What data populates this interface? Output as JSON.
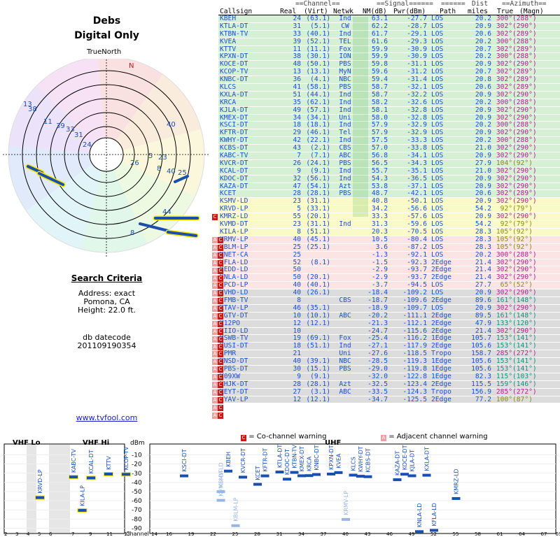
{
  "header": {
    "site_name": "Debs",
    "mode": "Digital Only",
    "north_label": "TrueNorth",
    "north_marker": "N"
  },
  "polar_labels": [
    "13",
    "38",
    "11",
    "39",
    "33",
    "31",
    "24",
    "40",
    "5",
    "23",
    "26",
    "8",
    "40",
    "25",
    "8",
    "44"
  ],
  "search": {
    "heading": "Search Criteria",
    "address": "Address: exact",
    "city": "Pomona, CA",
    "height": "Height: 22.0 ft.",
    "db_label": "db datecode",
    "db_value": "201109190354"
  },
  "link": "www.tvfool.com",
  "table_headers": {
    "group_channel": "==Channel==",
    "group_signal": "==Signal======",
    "group_dist": "Dist",
    "group_azimuth": "==Azimuth==",
    "callsign": "Callsign",
    "real": "Real",
    "virt": "(Virt)",
    "netwk": "Netwk",
    "nm": "NM(dB)",
    "pwr": "Pwr(dBm)",
    "path": "Path",
    "miles": "miles",
    "true": "True",
    "magn": "(Magn)"
  },
  "colors": {
    "green": "#d6f0d6",
    "yellow": "#fafac8",
    "pink": "#fbe4e4",
    "gray": "#dcdcdc",
    "blue": "#1a4fd0",
    "magenta": "#b02090",
    "olive": "#8a8a10",
    "teal": "#109080",
    "coch": "#c81818",
    "adj": "#e8a0a0"
  },
  "stations": [
    {
      "call": "KBEH",
      "real": "24",
      "virt": "(63.1)",
      "net": "Ind",
      "nm": "63.1",
      "pwr": "-27.7",
      "path": "LOS",
      "dist": "20.2",
      "az": "300°",
      "mag": "(288°)",
      "band": "green"
    },
    {
      "call": "KTLA-DT",
      "real": "31",
      "virt": "(5.1)",
      "net": "CW",
      "nm": "62.2",
      "pwr": "-28.7",
      "path": "LOS",
      "dist": "20.9",
      "az": "302°",
      "mag": "(290°)",
      "band": "green"
    },
    {
      "call": "KTBN-TV",
      "real": "33",
      "virt": "(40.1)",
      "net": "Ind",
      "nm": "61.7",
      "pwr": "-29.1",
      "path": "LOS",
      "dist": "20.6",
      "az": "302°",
      "mag": "(289°)",
      "band": "green"
    },
    {
      "call": "KVEA",
      "real": "39",
      "virt": "(52.1)",
      "net": "TEL",
      "nm": "61.6",
      "pwr": "-29.3",
      "path": "LOS",
      "dist": "20.2",
      "az": "300°",
      "mag": "(288°)",
      "band": "green"
    },
    {
      "call": "KTTV",
      "real": "11",
      "virt": "(11.1)",
      "net": "Fox",
      "nm": "59.9",
      "pwr": "-30.9",
      "path": "LOS",
      "dist": "20.7",
      "az": "302°",
      "mag": "(289°)",
      "band": "green"
    },
    {
      "call": "KPXN-DT",
      "real": "38",
      "virt": "(30.1)",
      "net": "ION",
      "nm": "59.9",
      "pwr": "-30.9",
      "path": "LOS",
      "dist": "20.2",
      "az": "300°",
      "mag": "(288°)",
      "band": "green"
    },
    {
      "call": "KOCE-DT",
      "real": "48",
      "virt": "(50.1)",
      "net": "PBS",
      "nm": "59.8",
      "pwr": "-31.1",
      "path": "LOS",
      "dist": "20.9",
      "az": "302°",
      "mag": "(290°)",
      "band": "green"
    },
    {
      "call": "KCOP-TV",
      "real": "13",
      "virt": "(13.1)",
      "net": "MyN",
      "nm": "59.6",
      "pwr": "-31.2",
      "path": "LOS",
      "dist": "20.7",
      "az": "302°",
      "mag": "(289°)",
      "band": "green"
    },
    {
      "call": "KNBC-DT",
      "real": "36",
      "virt": "(4.1)",
      "net": "NBC",
      "nm": "59.4",
      "pwr": "-31.4",
      "path": "LOS",
      "dist": "20.8",
      "az": "302°",
      "mag": "(289°)",
      "band": "green"
    },
    {
      "call": "KLCS",
      "real": "41",
      "virt": "(58.1)",
      "net": "PBS",
      "nm": "58.7",
      "pwr": "-32.1",
      "path": "LOS",
      "dist": "20.6",
      "az": "302°",
      "mag": "(289°)",
      "band": "green"
    },
    {
      "call": "KXLA-DT",
      "real": "51",
      "virt": "(44.1)",
      "net": "Ind",
      "nm": "58.7",
      "pwr": "-32.2",
      "path": "LOS",
      "dist": "20.9",
      "az": "302°",
      "mag": "(290°)",
      "band": "green"
    },
    {
      "call": "KRCA",
      "real": "35",
      "virt": "(62.1)",
      "net": "Ind",
      "nm": "58.2",
      "pwr": "-32.6",
      "path": "LOS",
      "dist": "20.2",
      "az": "300°",
      "mag": "(288°)",
      "band": "green"
    },
    {
      "call": "KJLA-DT",
      "real": "49",
      "virt": "(57.1)",
      "net": "Ind",
      "nm": "58.1",
      "pwr": "-32.8",
      "path": "LOS",
      "dist": "20.9",
      "az": "302°",
      "mag": "(290°)",
      "band": "green"
    },
    {
      "call": "KMEX-DT",
      "real": "34",
      "virt": "(34.1)",
      "net": "Uni",
      "nm": "58.0",
      "pwr": "-32.8",
      "path": "LOS",
      "dist": "20.9",
      "az": "302°",
      "mag": "(290°)",
      "band": "green"
    },
    {
      "call": "KSCI-DT",
      "real": "18",
      "virt": "(18.1)",
      "net": "Ind",
      "nm": "57.9",
      "pwr": "-32.9",
      "path": "LOS",
      "dist": "20.2",
      "az": "300°",
      "mag": "(288°)",
      "band": "green"
    },
    {
      "call": "KFTR-DT",
      "real": "29",
      "virt": "(46.1)",
      "net": "Tel",
      "nm": "57.9",
      "pwr": "-32.9",
      "path": "LOS",
      "dist": "20.9",
      "az": "302°",
      "mag": "(290°)",
      "band": "green"
    },
    {
      "call": "KWHY-DT",
      "real": "42",
      "virt": "(22.1)",
      "net": "Ind",
      "nm": "57.5",
      "pwr": "-33.3",
      "path": "LOS",
      "dist": "20.2",
      "az": "300°",
      "mag": "(288°)",
      "band": "green"
    },
    {
      "call": "KCBS-DT",
      "real": "43",
      "virt": "(2.1)",
      "net": "CBS",
      "nm": "57.0",
      "pwr": "-33.8",
      "path": "LOS",
      "dist": "21.0",
      "az": "302°",
      "mag": "(290°)",
      "band": "green"
    },
    {
      "call": "KABC-TV",
      "real": "7",
      "virt": "(7.1)",
      "net": "ABC",
      "nm": "56.8",
      "pwr": "-34.1",
      "path": "LOS",
      "dist": "20.9",
      "az": "302°",
      "mag": "(290°)",
      "band": "green"
    },
    {
      "call": "KVCR-DT",
      "real": "26",
      "virt": "(24.1)",
      "net": "PBS",
      "nm": "56.5",
      "pwr": "-34.3",
      "path": "LOS",
      "dist": "27.9",
      "az": "104°",
      "mag": "(92°)",
      "band": "green",
      "azc": "olive"
    },
    {
      "call": "KCAL-DT",
      "real": "9",
      "virt": "(9.1)",
      "net": "Ind",
      "nm": "55.7",
      "pwr": "-35.1",
      "path": "LOS",
      "dist": "21.0",
      "az": "302°",
      "mag": "(290°)",
      "band": "green"
    },
    {
      "call": "KDOC-DT",
      "real": "32",
      "virt": "(56.1)",
      "net": "Ind",
      "nm": "54.3",
      "pwr": "-36.5",
      "path": "LOS",
      "dist": "20.9",
      "az": "302°",
      "mag": "(290°)",
      "band": "green"
    },
    {
      "call": "KAZA-DT",
      "real": "47",
      "virt": "(54.1)",
      "net": "Azt",
      "nm": "53.8",
      "pwr": "-37.1",
      "path": "LOS",
      "dist": "20.9",
      "az": "302°",
      "mag": "(290°)",
      "band": "green"
    },
    {
      "call": "KCET",
      "real": "28",
      "virt": "(28.1)",
      "net": "PBS",
      "nm": "48.7",
      "pwr": "-42.1",
      "path": "LOS",
      "dist": "20.6",
      "az": "302°",
      "mag": "(289°)",
      "band": "green"
    },
    {
      "call": "KSMV-LD",
      "real": "23",
      "virt": "(31.1)",
      "net": "",
      "nm": "40.8",
      "pwr": "-50.1",
      "path": "LOS",
      "dist": "20.9",
      "az": "302°",
      "mag": "(290°)",
      "band": "yellow",
      "warn": "C"
    },
    {
      "call": "KRVD-LP",
      "real": "5",
      "virt": "(33.1)",
      "net": "",
      "nm": "34.2",
      "pwr": "-56.6",
      "path": "LOS",
      "dist": "54.2",
      "az": "92°",
      "mag": "(79°)",
      "band": "yellow",
      "azc": "olive"
    },
    {
      "call": "KMRZ-LD",
      "real": "55",
      "virt": "(20.1)",
      "net": "",
      "nm": "33.3",
      "pwr": "-57.6",
      "path": "LOS",
      "dist": "20.9",
      "az": "302°",
      "mag": "(290°)",
      "band": "yellow"
    },
    {
      "call": "KVMD-DT",
      "real": "23",
      "virt": "(31.1)",
      "net": "Ind",
      "nm": "31.3",
      "pwr": "-59.6",
      "path": "LOS",
      "dist": "54.2",
      "az": "92°",
      "mag": "(79°)",
      "band": "yellow",
      "warn": "AC",
      "azc": "olive"
    },
    {
      "call": "KILA-LP",
      "real": "8",
      "virt": "(51.1)",
      "net": "",
      "nm": "20.3",
      "pwr": "-70.5",
      "path": "LOS",
      "dist": "28.3",
      "az": "105°",
      "mag": "(92°)",
      "band": "yellow",
      "warn": "AC",
      "azc": "olive"
    },
    {
      "call": "KRMV-LP",
      "real": "40",
      "virt": "(45.1)",
      "net": "",
      "nm": "10.5",
      "pwr": "-80.4",
      "path": "LOS",
      "dist": "28.3",
      "az": "105°",
      "mag": "(92°)",
      "band": "pink",
      "warn": "AC",
      "azc": "olive"
    },
    {
      "call": "KBLM-LP",
      "real": "25",
      "virt": "(25.1)",
      "net": "",
      "nm": "3.6",
      "pwr": "-87.2",
      "path": "LOS",
      "dist": "28.3",
      "az": "105°",
      "mag": "(92°)",
      "band": "pink",
      "warn": "AC",
      "azc": "olive"
    },
    {
      "call": "KNET-CA",
      "real": "25",
      "virt": "",
      "net": "",
      "nm": "-1.3",
      "pwr": "-92.1",
      "path": "LOS",
      "dist": "20.2",
      "az": "300°",
      "mag": "(288°)",
      "band": "pink",
      "warn": "AC"
    },
    {
      "call": "KFLA-LD",
      "real": "52",
      "virt": "(8.1)",
      "net": "",
      "nm": "-1.5",
      "pwr": "-92.3",
      "path": "2Edge",
      "dist": "21.4",
      "az": "302°",
      "mag": "(290°)",
      "band": "pink",
      "warn": "AC"
    },
    {
      "call": "KEDD-LD",
      "real": "50",
      "virt": "",
      "net": "",
      "nm": "-2.9",
      "pwr": "-93.7",
      "path": "2Edge",
      "dist": "21.4",
      "az": "302°",
      "mag": "(290°)",
      "band": "pink",
      "warn": "AC"
    },
    {
      "call": "KNLA-LD",
      "real": "50",
      "virt": "(20.1)",
      "net": "",
      "nm": "-2.9",
      "pwr": "-93.7",
      "path": "2Edge",
      "dist": "21.4",
      "az": "302°",
      "mag": "(290°)",
      "band": "pink",
      "warn": "AC"
    },
    {
      "call": "KPCD-LP",
      "real": "40",
      "virt": "(40.1)",
      "net": "",
      "nm": "-3.7",
      "pwr": "-94.5",
      "path": "LOS",
      "dist": "27.7",
      "az": "65°",
      "mag": "(52°)",
      "band": "pink",
      "warn": "AC",
      "azc": "olive"
    },
    {
      "call": "KVHD-LD",
      "real": "40",
      "virt": "(26.1)",
      "net": "",
      "nm": "-18.4",
      "pwr": "-109.2",
      "path": "LOS",
      "dist": "20.9",
      "az": "302°",
      "mag": "(290°)",
      "band": "gray",
      "warn": "AC"
    },
    {
      "call": "KFMB-TV",
      "real": "8",
      "virt": "",
      "net": "CBS",
      "nm": "-18.7",
      "pwr": "-109.6",
      "path": "2Edge",
      "dist": "89.6",
      "az": "161°",
      "mag": "(148°)",
      "band": "gray",
      "warn": "AC",
      "azc": "teal"
    },
    {
      "call": "KTAV-LP",
      "real": "46",
      "virt": "(35.1)",
      "net": "",
      "nm": "-18.9",
      "pwr": "-109.7",
      "path": "LOS",
      "dist": "20.9",
      "az": "302°",
      "mag": "(290°)",
      "band": "gray",
      "warn": "AC"
    },
    {
      "call": "KGTV-DT",
      "real": "10",
      "virt": "(10.1)",
      "net": "ABC",
      "nm": "-20.2",
      "pwr": "-111.1",
      "path": "2Edge",
      "dist": "89.5",
      "az": "161°",
      "mag": "(148°)",
      "band": "gray",
      "warn": "AC",
      "azc": "teal"
    },
    {
      "call": "K12PO",
      "real": "12",
      "virt": "(12.1)",
      "net": "",
      "nm": "-21.3",
      "pwr": "-112.1",
      "path": "2Edge",
      "dist": "47.9",
      "az": "133°",
      "mag": "(120°)",
      "band": "gray",
      "warn": "AC",
      "azc": "teal"
    },
    {
      "call": "KIIO-LD",
      "real": "10",
      "virt": "",
      "net": "",
      "nm": "-24.7",
      "pwr": "-115.6",
      "path": "2Edge",
      "dist": "21.4",
      "az": "302°",
      "mag": "(290°)",
      "band": "gray",
      "warn": "AC"
    },
    {
      "call": "KSWB-TV",
      "real": "19",
      "virt": "(69.1)",
      "net": "Fox",
      "nm": "-25.4",
      "pwr": "-116.2",
      "path": "1Edge",
      "dist": "105.7",
      "az": "153°",
      "mag": "(141°)",
      "band": "gray",
      "warn": "AC",
      "azc": "teal"
    },
    {
      "call": "KUSI-DT",
      "real": "18",
      "virt": "(51.1)",
      "net": "Ind",
      "nm": "-27.1",
      "pwr": "-117.9",
      "path": "2Edge",
      "dist": "105.6",
      "az": "153°",
      "mag": "(141°)",
      "band": "gray",
      "warn": "AC",
      "azc": "teal"
    },
    {
      "call": "KPMR",
      "real": "21",
      "virt": "",
      "net": "Uni",
      "nm": "-27.6",
      "pwr": "-118.5",
      "path": "Tropo",
      "dist": "158.7",
      "az": "285°",
      "mag": "(272°)",
      "band": "gray",
      "warn": "AC"
    },
    {
      "call": "KNSD-DT",
      "real": "40",
      "virt": "(39.1)",
      "net": "NBC",
      "nm": "-28.5",
      "pwr": "-119.3",
      "path": "1Edge",
      "dist": "105.6",
      "az": "153°",
      "mag": "(141°)",
      "band": "gray",
      "warn": "AC",
      "azc": "teal"
    },
    {
      "call": "KPBS-DT",
      "real": "30",
      "virt": "(15.1)",
      "net": "PBS",
      "nm": "-29.0",
      "pwr": "-119.8",
      "path": "1Edge",
      "dist": "105.6",
      "az": "153°",
      "mag": "(141°)",
      "band": "gray",
      "warn": "AC",
      "azc": "teal"
    },
    {
      "call": "K09XW",
      "real": "9",
      "virt": "(9.1)",
      "net": "",
      "nm": "-32.0",
      "pwr": "-122.8",
      "path": "1Edge",
      "dist": "82.3",
      "az": "115°",
      "mag": "(103°)",
      "band": "gray",
      "warn": "AC",
      "azc": "teal"
    },
    {
      "call": "XHJK-DT",
      "real": "28",
      "virt": "(28.1)",
      "net": "Azt",
      "nm": "-32.5",
      "pwr": "-123.4",
      "path": "2Edge",
      "dist": "115.5",
      "az": "159°",
      "mag": "(146°)",
      "band": "gray",
      "warn": "AC",
      "azc": "teal"
    },
    {
      "call": "KEYT-DT",
      "real": "27",
      "virt": "(3.1)",
      "net": "ABC",
      "nm": "-33.5",
      "pwr": "-124.3",
      "path": "Tropo",
      "dist": "156.9",
      "az": "285°",
      "mag": "(272°)",
      "band": "gray",
      "warn": "AC"
    },
    {
      "call": "KYAV-LP",
      "real": "12",
      "virt": "(12.1)",
      "net": "",
      "nm": "-34.7",
      "pwr": "-125.5",
      "path": "2Edge",
      "dist": "77.2",
      "az": "100°",
      "mag": "(87°)",
      "band": "gray",
      "warn": "AC",
      "azc": "olive"
    }
  ],
  "legend": {
    "co_label": "= Co-channel warning",
    "adj_label": "= Adjacent channel warning",
    "co_mark": "C",
    "adj_mark": "A"
  },
  "bottom_chart": {
    "vhf_lo": "VHF Lo",
    "vhf_hi": "VHF Hi",
    "uhf": "UHF",
    "unit": "dBm",
    "channel_label": "Channel",
    "dbm_ticks": [
      "-10",
      "-20",
      "-30",
      "-40",
      "-50",
      "-60",
      "-70",
      "-80",
      "-90"
    ],
    "vhf_lo_ticks": [
      "2",
      "3",
      "4",
      "5",
      "6"
    ],
    "vhf_hi_ticks": [
      "7",
      "9",
      "11",
      "13"
    ],
    "uhf_ticks": [
      "14",
      "16",
      "19",
      "22",
      "25",
      "28",
      "31",
      "34",
      "37",
      "40",
      "43",
      "46",
      "49",
      "52",
      "55",
      "58",
      "61",
      "64",
      "67",
      "69"
    ],
    "bars": [
      {
        "label": "KRVD-LP",
        "ch": 5,
        "dbm": -56.6,
        "strong": true
      },
      {
        "label": "KABC-TV",
        "ch": 7,
        "dbm": -34.1,
        "strong": true
      },
      {
        "label": "KILA-LP",
        "ch": 8,
        "dbm": -70.5,
        "strong": true
      },
      {
        "label": "KCAL-DT",
        "ch": 9,
        "dbm": -35.1,
        "strong": true
      },
      {
        "label": "KTTV",
        "ch": 11,
        "dbm": -30.9,
        "strong": true
      },
      {
        "label": "KCOP-TV",
        "ch": 13,
        "dbm": -31.2,
        "strong": true
      },
      {
        "label": "KSCI-DT",
        "ch": 18,
        "dbm": -32.9
      },
      {
        "label": "KSMV-LD",
        "ch": 23,
        "dbm": -50.1,
        "faint": true
      },
      {
        "label": "KVMD-DT",
        "ch": 23,
        "dbm": -59.6,
        "faint": true
      },
      {
        "label": "KBEH",
        "ch": 24,
        "dbm": -27.7
      },
      {
        "label": "KBLM-LP",
        "ch": 25,
        "dbm": -87.2,
        "faint": true
      },
      {
        "label": "KVCR-DT",
        "ch": 26,
        "dbm": -34.3
      },
      {
        "label": "KCET",
        "ch": 28,
        "dbm": -42.1
      },
      {
        "label": "KFTR-DT",
        "ch": 29,
        "dbm": -32.9
      },
      {
        "label": "KTLA-DT",
        "ch": 31,
        "dbm": -28.7
      },
      {
        "label": "KDOC-DT",
        "ch": 32,
        "dbm": -36.5
      },
      {
        "label": "KTBN-TV",
        "ch": 33,
        "dbm": -29.1
      },
      {
        "label": "KMEX-DT",
        "ch": 34,
        "dbm": -32.8
      },
      {
        "label": "KRCA",
        "ch": 35,
        "dbm": -32.6
      },
      {
        "label": "KNBC-DT",
        "ch": 36,
        "dbm": -31.4
      },
      {
        "label": "KPXN-DT",
        "ch": 38,
        "dbm": -30.9
      },
      {
        "label": "KVEA",
        "ch": 39,
        "dbm": -29.3
      },
      {
        "label": "KRMV-LP",
        "ch": 40,
        "dbm": -80.4,
        "faint": true
      },
      {
        "label": "KLCS",
        "ch": 41,
        "dbm": -32.1
      },
      {
        "label": "KWHY-DT",
        "ch": 42,
        "dbm": -33.3
      },
      {
        "label": "KCBS-DT",
        "ch": 43,
        "dbm": -33.8
      },
      {
        "label": "KAZA-DT",
        "ch": 47,
        "dbm": -37.1
      },
      {
        "label": "KOCE-DT",
        "ch": 48,
        "dbm": -31.1
      },
      {
        "label": "KJLA-DT",
        "ch": 49,
        "dbm": -32.8
      },
      {
        "label": "KNLA-LD",
        "ch": 50,
        "dbm": -93.7
      },
      {
        "label": "KXLA-DT",
        "ch": 51,
        "dbm": -32.2
      },
      {
        "label": "KFLA-LD",
        "ch": 52,
        "dbm": -92.3
      },
      {
        "label": "KMRZ-LD",
        "ch": 55,
        "dbm": -57.6
      }
    ]
  }
}
